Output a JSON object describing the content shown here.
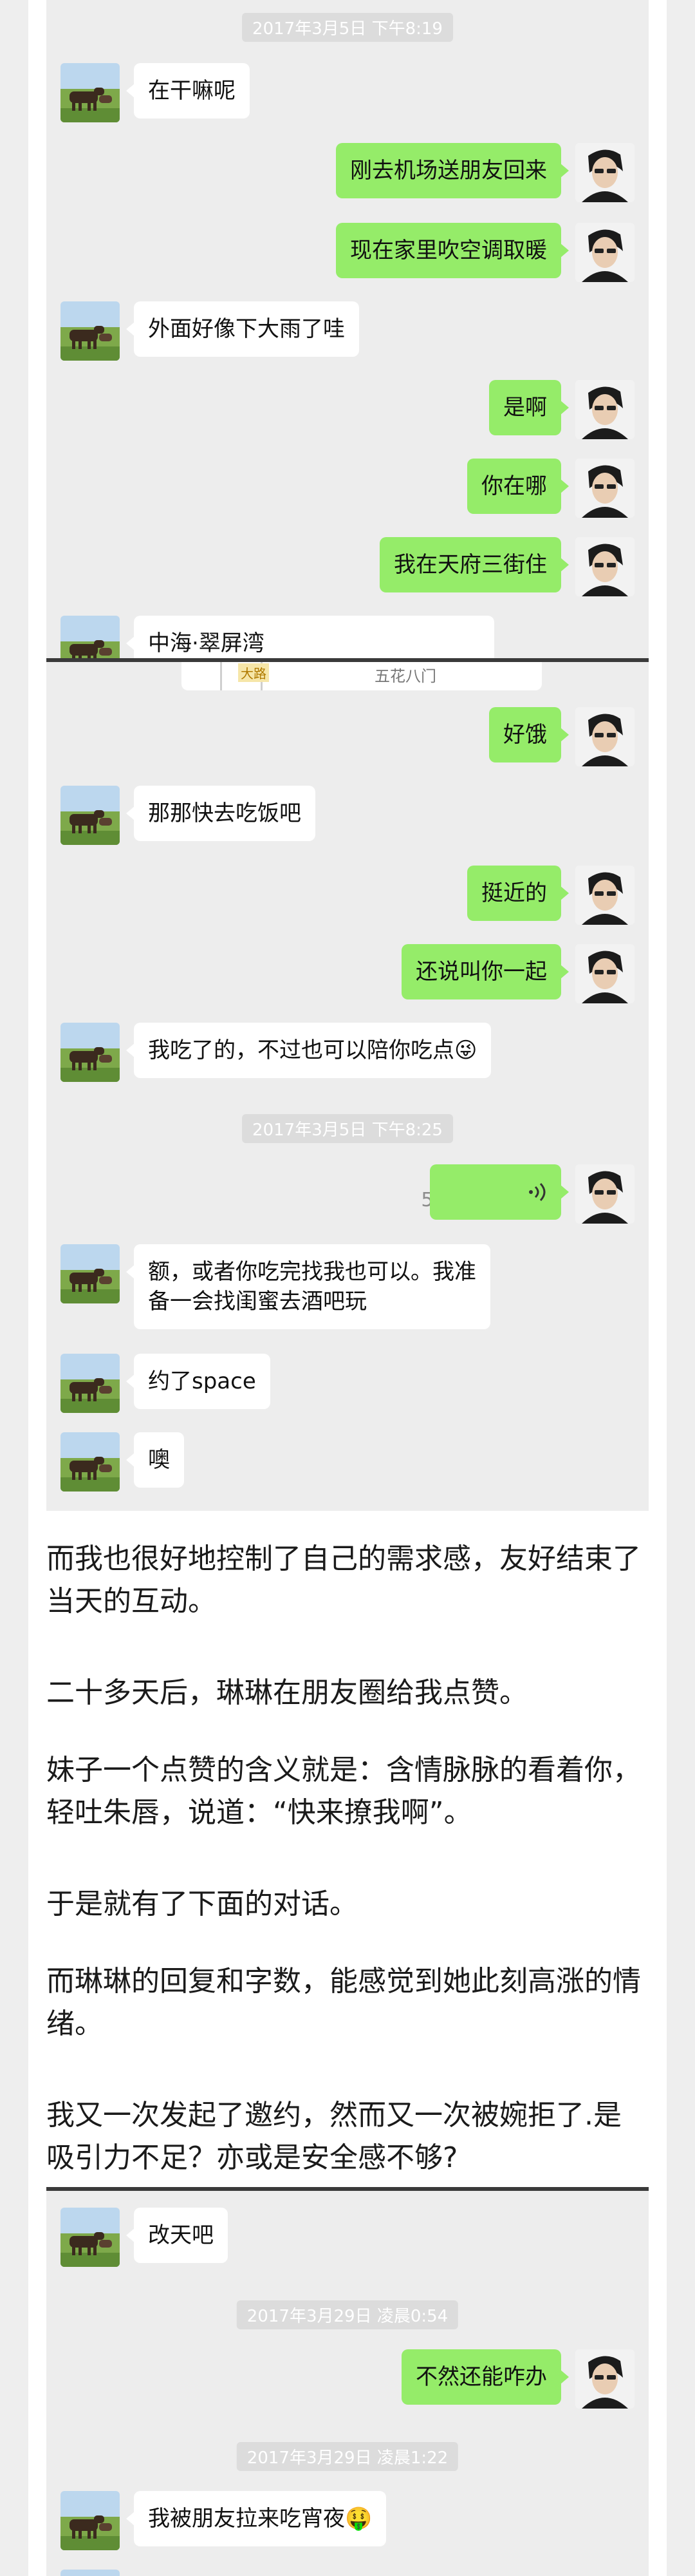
{
  "colors": {
    "outgoing_bubble": "#95ec69",
    "incoming_bubble": "#ffffff",
    "chat_bg": "#ededed",
    "timestamp_bg": "#dcdcdc"
  },
  "icons": {
    "incoming_avatar": "horse-on-grass-avatar",
    "outgoing_avatar": "man-portrait-avatar",
    "voice": "voice-wave-icon"
  },
  "chat1": {
    "ts1": "2017年3月5日 下午8:19",
    "m1": "在干嘛呢",
    "m2": "刚去机场送朋友回来",
    "m3": "现在家里吹空调取暖",
    "m4": "外面好像下大雨了哇",
    "m5": "是啊",
    "m6": "你在哪",
    "m7": "我在天府三街住",
    "m8": "中海·翠屏湾",
    "map_label": "五花八门",
    "map_sign": "大路"
  },
  "chat2": {
    "m1": "好饿",
    "m2": "那那快去吃饭吧",
    "m3": "挺近的",
    "m4": "还说叫你一起",
    "m5": "我吃了的，不过也可以陪你吃点😜",
    "ts2": "2017年3月5日 下午8:25",
    "voice_duration": "5''",
    "m6_line1": "额，或者你吃完找我也可以。我准",
    "m6_line2": "备一会找闺蜜去酒吧玩",
    "m7": "约了space",
    "m8": "噢"
  },
  "article": {
    "p1": "而我也很好地控制了自己的需求感，友好结束了当天的互动。",
    "p2": "二十多天后，琳琳在朋友圈给我点赞。",
    "p3": "妹子一个点赞的含义就是：含情脉脉的看着你，轻吐朱唇，说道：“快来撩我啊”。",
    "p4": "于是就有了下面的对话。",
    "p5": " 而琳琳的回复和字数，能感觉到她此刻高涨的情绪。",
    "p6": "我又一次发起了邀约，然而又一次被婉拒了.是吸引力不足？亦或是安全感不够?"
  },
  "chat3": {
    "m1": "改天吧",
    "ts3": "2017年3月29日 凌晨0:54",
    "m2": "不然还能咋办",
    "ts4": "2017年3月29日 凌晨1:22",
    "m3": "我被朋友拉来吃宵夜🤑"
  }
}
